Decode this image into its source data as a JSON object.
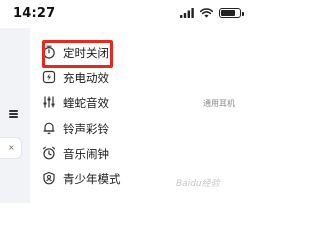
{
  "status_bar": {
    "time": "14:27",
    "icons": [
      "signal-icon",
      "wifi-icon",
      "battery-icon"
    ],
    "battery_level": 0.8
  },
  "drawer": {
    "items": [
      {
        "label": "定时关闭",
        "icon": "timer-icon",
        "extra": ""
      },
      {
        "label": "充电动效",
        "icon": "charging-icon",
        "extra": ""
      },
      {
        "label": "蝰蛇音效",
        "icon": "equalizer-icon",
        "extra": "通用耳机"
      },
      {
        "label": "铃声彩铃",
        "icon": "bell-icon",
        "extra": ""
      },
      {
        "label": "音乐闹钟",
        "icon": "alarm-clock-icon",
        "extra": ""
      },
      {
        "label": "青少年模式",
        "icon": "teen-mode-icon",
        "extra": ""
      }
    ]
  },
  "left_panel": {
    "close_glyph": "×"
  },
  "watermark": {
    "text": "Baidu经验"
  },
  "colors": {
    "highlight": "#e52a1d",
    "panel_bg": "#f2f3f6"
  }
}
